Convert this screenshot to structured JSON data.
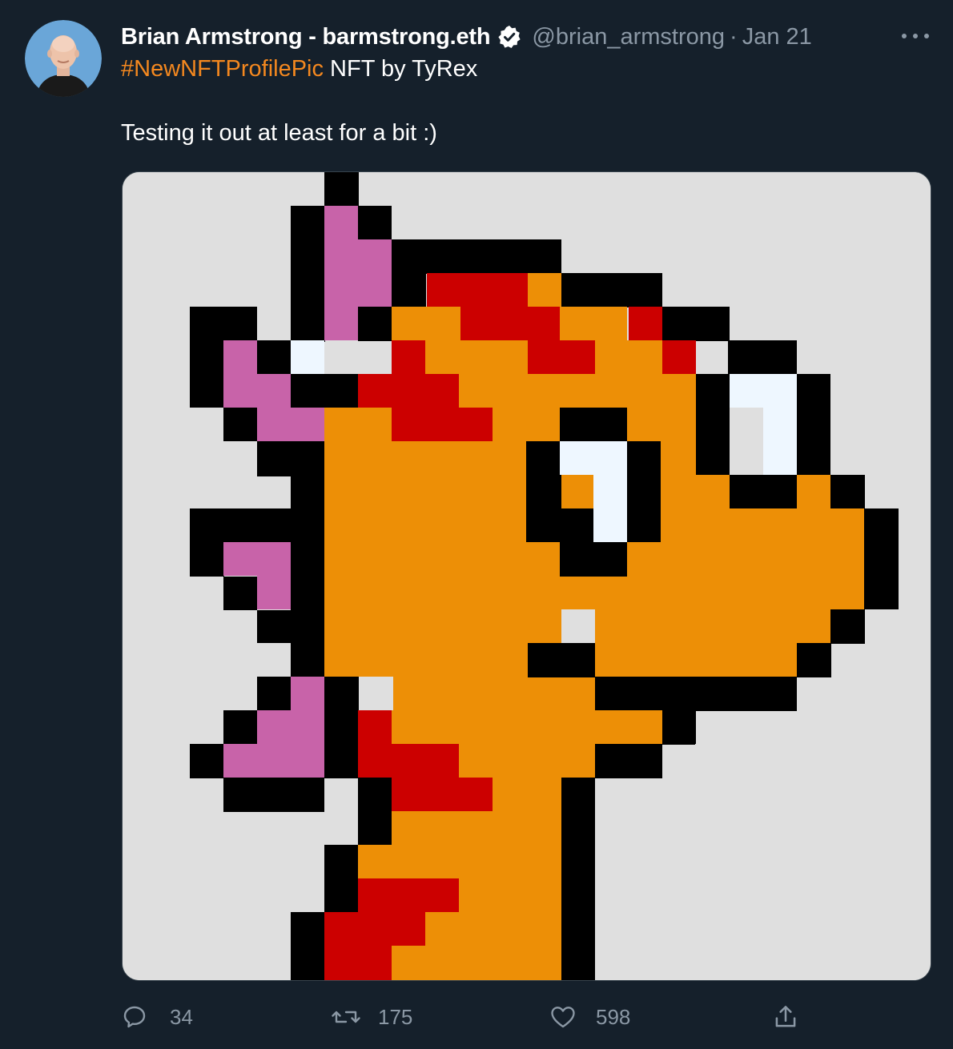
{
  "tweet": {
    "author": {
      "display_name": "Brian Armstrong - barmstrong.eth",
      "handle": "@brian_armstrong",
      "verified": true
    },
    "separator": "·",
    "timestamp": "Jan 21",
    "hashtag": "#NewNFTProfilePic",
    "headline_rest": " NFT by TyRex",
    "text": "Testing it out at least for a bit :)",
    "media": {
      "kind": "pixel-art image",
      "palette": {
        "background": "#dfdfdf",
        "outline": "#000000",
        "skin": "#ed8f06",
        "spots": "#cc0000",
        "frills": "#c863a9",
        "eye_white": "#eef7ff"
      }
    },
    "actions": [
      {
        "name": "reply",
        "icon": "reply-icon",
        "count": "34"
      },
      {
        "name": "retweet",
        "icon": "retweet-icon",
        "count": "175"
      },
      {
        "name": "like",
        "icon": "heart-icon",
        "count": "598"
      },
      {
        "name": "share",
        "icon": "share-icon",
        "count": ""
      }
    ],
    "colors": {
      "background": "#15202b",
      "secondary_text": "#8b98a5",
      "hashtag": "#f4881f"
    }
  }
}
